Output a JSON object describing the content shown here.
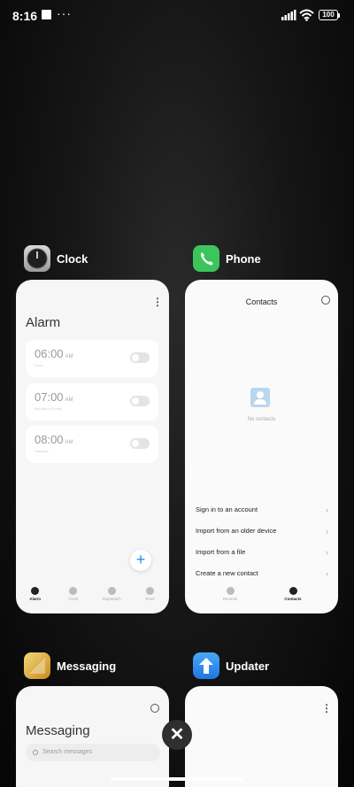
{
  "status_bar": {
    "time": "8:16",
    "dots": "···",
    "battery": "100"
  },
  "apps": [
    {
      "name": "Clock",
      "icon": "clock-icon"
    },
    {
      "name": "Phone",
      "icon": "phone-icon"
    },
    {
      "name": "Messaging",
      "icon": "messaging-icon"
    },
    {
      "name": "Updater",
      "icon": "updater-icon"
    }
  ],
  "clock_card": {
    "menu_glyph": "⋮",
    "title": "Alarm",
    "alarms": [
      {
        "time": "06:00",
        "ampm": "AM",
        "sub": "Once"
      },
      {
        "time": "07:00",
        "ampm": "AM",
        "sub": "Monday to Friday"
      },
      {
        "time": "08:00",
        "ampm": "AM",
        "sub": "Sundays"
      }
    ],
    "fab_glyph": "+",
    "nav": [
      "Alarm",
      "Clock",
      "Stopwatch",
      "Timer"
    ]
  },
  "phone_card": {
    "title": "Contacts",
    "empty_text": "No contacts",
    "options": [
      "Sign in to an account",
      "Import from an older device",
      "Import from a file",
      "Create a new contact"
    ],
    "chevron": "›",
    "nav": [
      "Recents",
      "Contacts"
    ]
  },
  "messaging_card": {
    "title": "Messaging",
    "search_placeholder": "Search messages"
  },
  "updater_card": {
    "menu_glyph": "⋮"
  },
  "close_glyph": "✕",
  "colors": {
    "phone_green": "#3cc55a",
    "updater_blue": "#2f8ef0",
    "accent": "#2a8cf0"
  }
}
